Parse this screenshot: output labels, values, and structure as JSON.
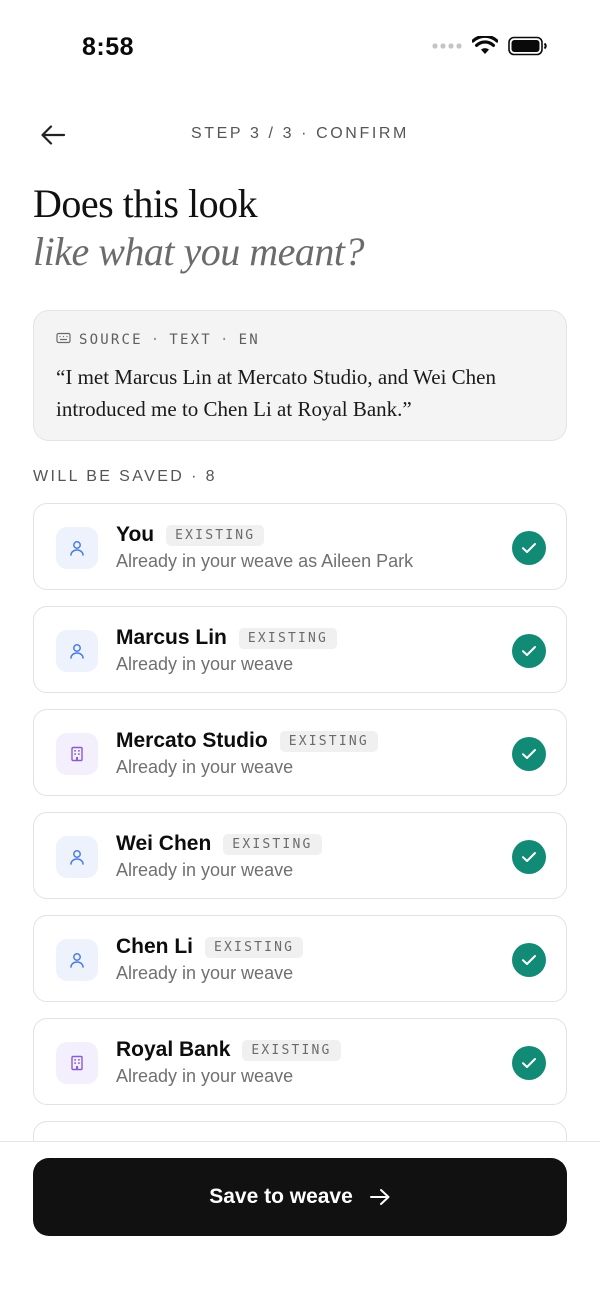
{
  "status_bar": {
    "time": "8:58"
  },
  "header": {
    "step_label": "STEP 3 / 3 · CONFIRM"
  },
  "title": {
    "line1": "Does this look",
    "line2": "like what you meant?"
  },
  "source": {
    "label": "SOURCE",
    "kind": "TEXT",
    "language": "EN",
    "quote": "“I met Marcus Lin at Mercato Studio, and Wei Chen introduced me to Chen Li at Royal Bank.”"
  },
  "section": {
    "label": "WILL BE SAVED · 8"
  },
  "entities": [
    {
      "name": "You",
      "badge": "EXISTING",
      "subtitle": "Already in your weave as Aileen Park",
      "type": "person-icon"
    },
    {
      "name": "Marcus Lin",
      "badge": "EXISTING",
      "subtitle": "Already in your weave",
      "type": "person-icon"
    },
    {
      "name": "Mercato Studio",
      "badge": "EXISTING",
      "subtitle": "Already in your weave",
      "type": "building-icon"
    },
    {
      "name": "Wei Chen",
      "badge": "EXISTING",
      "subtitle": "Already in your weave",
      "type": "person-icon"
    },
    {
      "name": "Chen Li",
      "badge": "EXISTING",
      "subtitle": "Already in your weave",
      "type": "person-icon"
    },
    {
      "name": "Royal Bank",
      "badge": "EXISTING",
      "subtitle": "Already in your weave",
      "type": "building-icon"
    }
  ],
  "actions": {
    "save_label": "Save to weave"
  },
  "colors": {
    "accent_check": "#118a76",
    "button_bg": "#111111",
    "person_icon": "#4a7de0",
    "org_icon": "#8a5bd0"
  }
}
